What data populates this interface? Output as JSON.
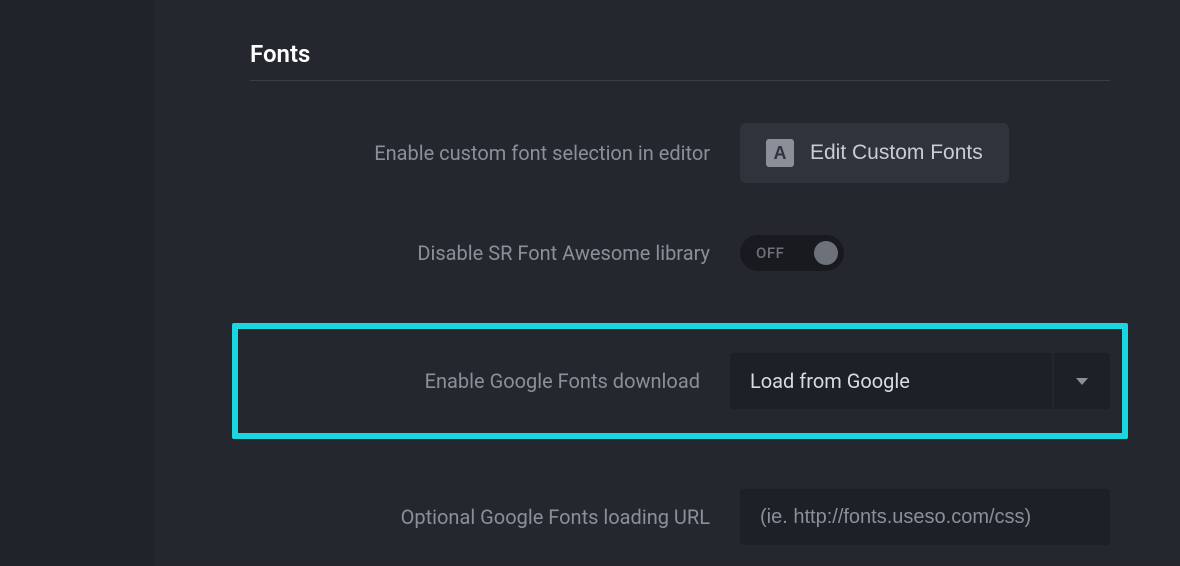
{
  "section": {
    "title": "Fonts"
  },
  "rows": {
    "customFont": {
      "label": "Enable custom font selection in editor",
      "buttonIconLetter": "A",
      "buttonLabel": "Edit Custom Fonts"
    },
    "disableFA": {
      "label": "Disable SR Font Awesome library",
      "toggleState": "OFF"
    },
    "googleFonts": {
      "label": "Enable Google Fonts download",
      "selected": "Load from Google"
    },
    "loadingUrl": {
      "label": "Optional Google Fonts loading URL",
      "placeholder": "(ie. http://fonts.useso.com/css)"
    }
  }
}
